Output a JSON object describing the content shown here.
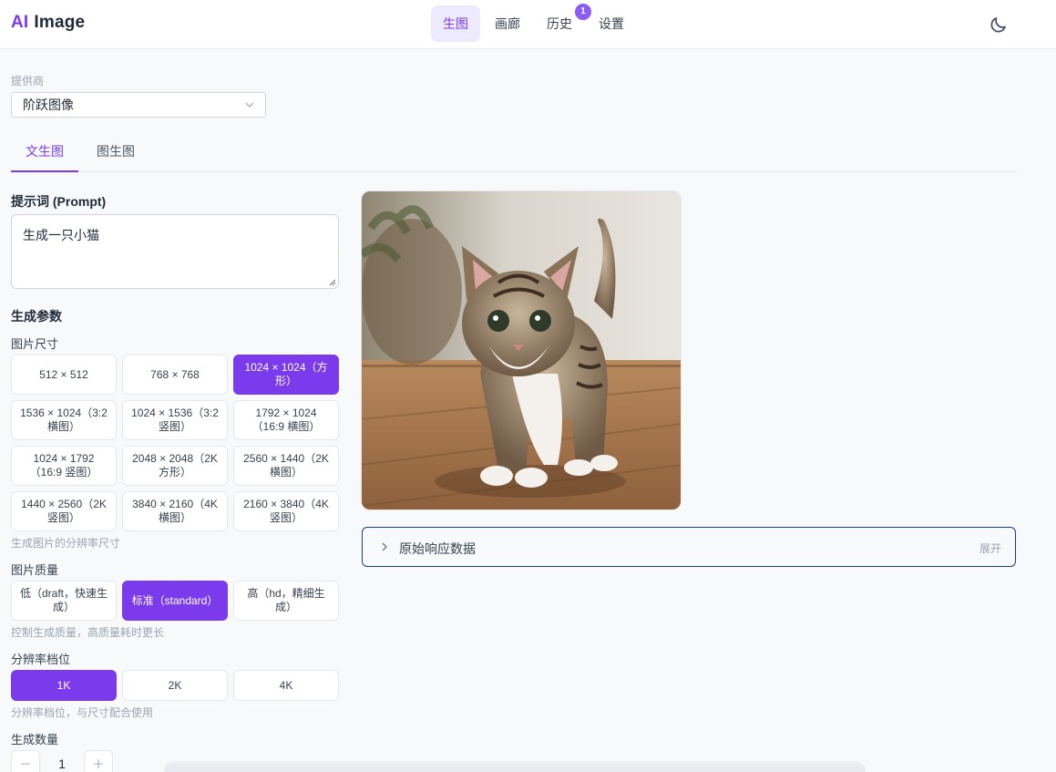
{
  "app": {
    "logo_ai": "AI",
    "logo_name": "Image"
  },
  "nav": {
    "tabs": [
      {
        "label": "生图",
        "active": true
      },
      {
        "label": "画廊"
      },
      {
        "label": "历史",
        "badge": "1"
      },
      {
        "label": "设置"
      }
    ],
    "theme_icon": "moon-icon"
  },
  "provider": {
    "label": "提供商",
    "value": "阶跃图像"
  },
  "mode_tabs": [
    {
      "label": "文生图",
      "active": true
    },
    {
      "label": "图生图"
    }
  ],
  "prompt": {
    "label": "提示词 (Prompt)",
    "value": "生成一只小猫"
  },
  "params": {
    "title": "生成参数",
    "size": {
      "label": "图片尺寸",
      "options": [
        "512 × 512",
        "768 × 768",
        "1024 × 1024（方形）",
        "1536 × 1024（3:2 横图）",
        "1024 × 1536（3:2 竖图）",
        "1792 × 1024（16:9 横图）",
        "1024 × 1792（16:9 竖图）",
        "2048 × 2048（2K 方形）",
        "2560 × 1440（2K 横图）",
        "1440 × 2560（2K 竖图）",
        "3840 × 2160（4K 横图）",
        "2160 × 3840（4K 竖图）"
      ],
      "selected": "1024 × 1024（方形）",
      "hint": "生成图片的分辨率尺寸"
    },
    "quality": {
      "label": "图片质量",
      "options": [
        "低（draft，快速生成）",
        "标准（standard）",
        "高（hd，精细生成）"
      ],
      "selected": "标准（standard）",
      "hint": "控制生成质量，高质量耗时更长"
    },
    "tier": {
      "label": "分辨率档位",
      "options": [
        "1K",
        "2K",
        "4K"
      ],
      "selected": "1K",
      "hint": "分辨率档位，与尺寸配合使用"
    },
    "count": {
      "label": "生成数量",
      "value": "1",
      "minus": "－",
      "plus": "＋"
    }
  },
  "result": {
    "raw_panel_title": "原始响应数据",
    "raw_panel_action": "展开"
  },
  "colors": {
    "accent": "#7c3aed",
    "accent_light": "#ede9fe",
    "border_focus": "#1e3a8a"
  }
}
